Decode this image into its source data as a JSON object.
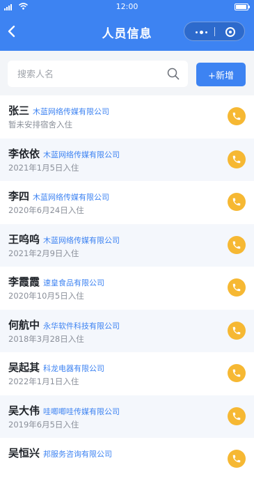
{
  "status_bar": {
    "time": "12:00"
  },
  "header": {
    "title": "人员信息"
  },
  "search": {
    "placeholder": "搜索人名",
    "value": "",
    "add_label": "+新增"
  },
  "colors": {
    "primary": "#3d83f2",
    "phone": "#f6b833"
  },
  "people": [
    {
      "name": "张三",
      "company": "木蓝网络传媒有限公司",
      "status": "暂未安排宿舍入住"
    },
    {
      "name": "李依依",
      "company": "木蓝网络传媒有限公司",
      "status": "2021年1月5日入住"
    },
    {
      "name": "李四",
      "company": "木蓝网络传媒有限公司",
      "status": "2020年6月24日入住"
    },
    {
      "name": "王呜呜",
      "company": "木蓝网络传媒有限公司",
      "status": "2021年2月9日入住"
    },
    {
      "name": "李霞霞",
      "company": "速皇食品有限公司",
      "status": "2020年10月5日入住"
    },
    {
      "name": "何航中",
      "company": "永华软件科技有限公司",
      "status": "2018年3月28日入住"
    },
    {
      "name": "吴起其",
      "company": "科龙电器有限公司",
      "status": "2022年1月1日入住"
    },
    {
      "name": "吴大伟",
      "company": "哇唧唧哇传媒有限公司",
      "status": "2019年6月5日入住"
    },
    {
      "name": "吴恒兴",
      "company": "邦服务咨询有限公司",
      "status": ""
    }
  ]
}
